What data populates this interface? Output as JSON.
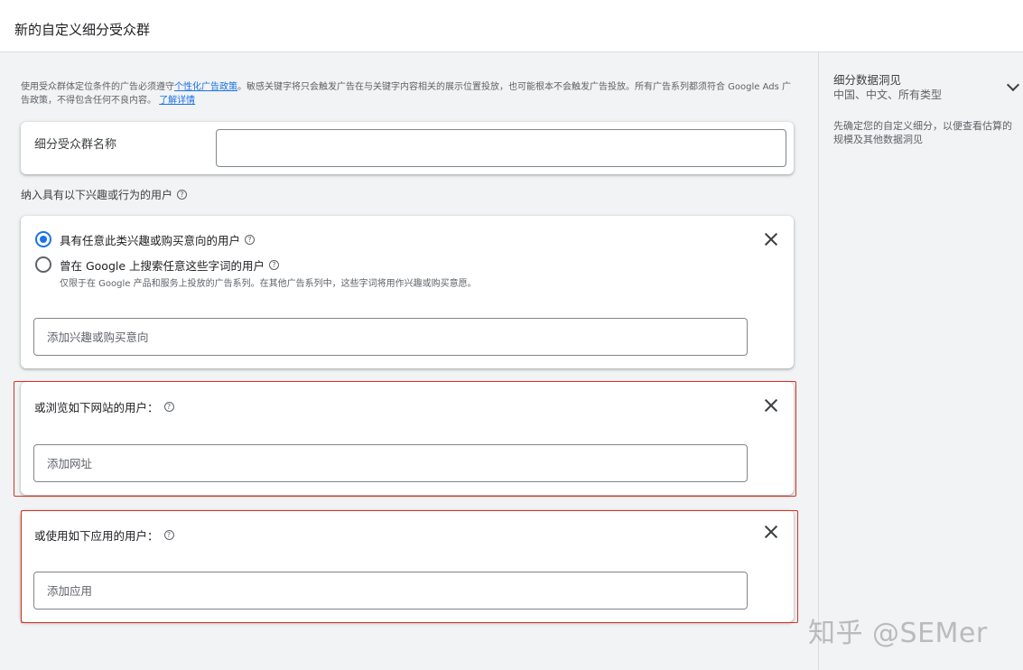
{
  "header": {
    "title": "新的自定义细分受众群"
  },
  "policy": {
    "text_before": "使用受众群体定位条件的广告必须遵守",
    "link1": "个性化广告政策",
    "text_after": "。敏感关键字将只会触发广告在与关键字内容相关的展示位置投放，也可能根本不会触发广告投放。所有广告系列都须符合 Google Ads 广告政策，不得包含任何不良内容。",
    "link2": "了解详情"
  },
  "name_card": {
    "label": "细分受众群名称",
    "value": ""
  },
  "include_section": {
    "label": "纳入具有以下兴趣或行为的用户",
    "help": "?"
  },
  "interest_card": {
    "option1": "具有任意此类兴趣或购买意向的用户",
    "option2": "曾在 Google 上搜索任意这些字词的用户",
    "option2_sub": "仅限于在 Google 产品和服务上投放的广告系列。在其他广告系列中，这些字词将用作兴趣或购买意愿。",
    "selected": 1,
    "input_placeholder": "添加兴趣或购买意向"
  },
  "website_card": {
    "title": "或浏览如下网站的用户：",
    "input_placeholder": "添加网址"
  },
  "app_card": {
    "title": "或使用如下应用的用户：",
    "input_placeholder": "添加应用"
  },
  "sidebar": {
    "title": "细分数据洞见",
    "subtitle": "中国、中文、所有类型",
    "description": "先确定您的自定义细分，以便查看估算的规模及其他数据洞见"
  },
  "watermark": "知乎 @SEMer",
  "colors": {
    "accent": "#1a73e8",
    "highlight_border": "#d93025"
  }
}
